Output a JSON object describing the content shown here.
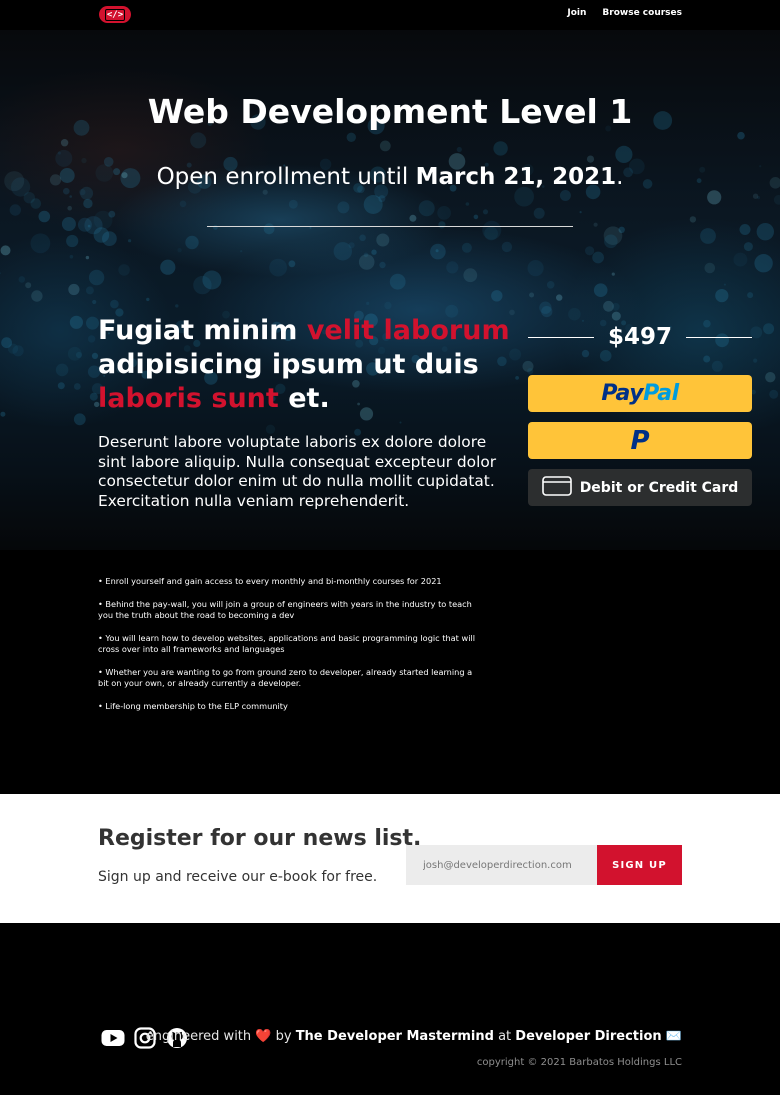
{
  "nav": {
    "logo_text": "</>",
    "links": [
      "Join",
      "Browse courses"
    ]
  },
  "hero": {
    "title": "Web Development Level 1",
    "subtitle_prefix": "Open enrollment until ",
    "subtitle_date": "March 21, 2021",
    "subtitle_suffix": "."
  },
  "offer": {
    "headline_1": "Fugiat minim ",
    "headline_2": "velit laborum",
    "headline_3": " adipisicing ipsum ut duis ",
    "headline_4": "laboris sunt",
    "headline_5": " et.",
    "description": "Deserunt labore voluptate laboris ex dolore dolore sint labore aliquip. Nulla consequat excepteur dolor consectetur dolor enim ut do nulla mollit cupidatat. Exercitation nulla veniam reprehenderit.",
    "price": "$497",
    "paypal_label_a": "Pay",
    "paypal_label_b": "Pal",
    "paypal_mark": "P",
    "card_label": "Debit or Credit Card"
  },
  "benefits": [
    "• Enroll yourself and gain access to every monthly and bi-monthly courses for 2021",
    "• Behind the pay-wall, you will join a group of engineers with years in the industry to teach you the truth about the road to becoming a dev",
    "• You will learn how to develop websites, applications and basic programming logic that will cross over into all frameworks and languages",
    "• Whether you are wanting to go from ground zero to developer, already started learning a bit on your own, or already currently a developer.",
    "• Life-long membership to the ELP community"
  ],
  "newsletter": {
    "title": "Register for our news list.",
    "subtitle": "Sign up and receive our e-book for free.",
    "placeholder": "josh@developerdirection.com",
    "button": "SIGN UP"
  },
  "footer": {
    "icons": [
      "youtube-icon",
      "instagram-icon",
      "github-icon"
    ],
    "credit_prefix": "engineered with ",
    "heart": "❤️",
    "credit_by": " by ",
    "credit_who": "The Developer Mastermind",
    "credit_at": " at ",
    "credit_org": "Developer Direction",
    "mail": "✉️",
    "copyright": "copyright © 2021 Barbatos Holdings LLC"
  },
  "colors": {
    "accent_red": "#d2122e",
    "paypal_yellow": "#ffc439",
    "card_dark": "#2c2e2f"
  }
}
